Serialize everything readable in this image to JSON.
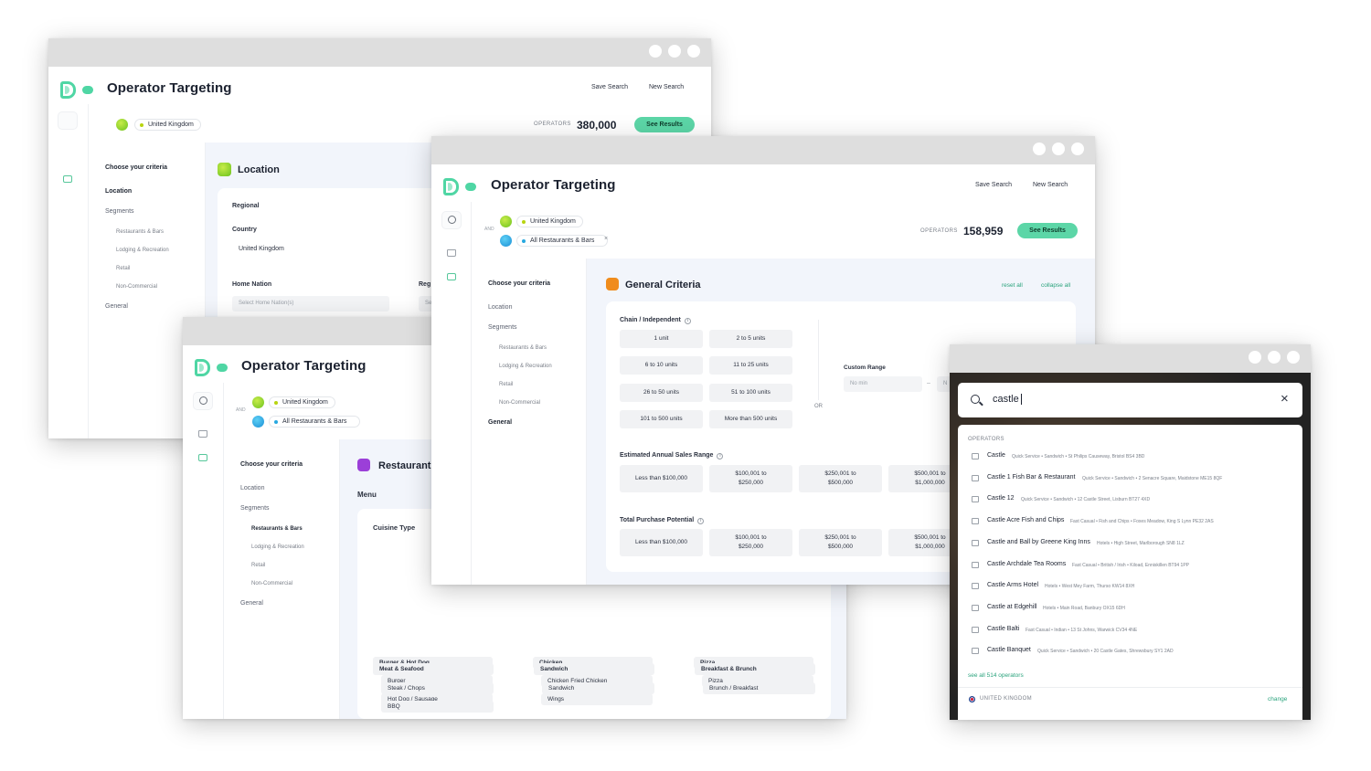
{
  "app": {
    "title": "Operator Targeting",
    "save_search": "Save Search",
    "new_search": "New Search",
    "operators_label": "OPERATORS",
    "see_results": "See Results",
    "and_label": "AND",
    "choose_criteria": "Choose your criteria"
  },
  "brand_colors": {
    "accent": "#5cd6a7",
    "logo": "#4fd6a4",
    "link": "#2aa37c",
    "panel": "#f2f5fb"
  },
  "nav": {
    "location": "Location",
    "segments": "Segments",
    "sub": [
      "Restaurants & Bars",
      "Lodging & Recreation",
      "Retail",
      "Non-Commercial"
    ],
    "general": "General"
  },
  "win1": {
    "filter_pill": "United Kingdom",
    "operators_count": "380,000",
    "section_title": "Location",
    "regional": "Regional",
    "country_label": "Country",
    "country_value": "United Kingdom",
    "home_nation_label": "Home Nation",
    "home_nation_placeholder": "Select Home Nation(s)",
    "region_label_partial": "Reg",
    "region_placeholder_partial": "Se"
  },
  "win3": {
    "filter_location": "United Kingdom",
    "filter_segment": "All Restaurants & Bars",
    "section_title_partial": "Restaurant",
    "menu_label": "Menu",
    "cuisine_label": "Cuisine Type",
    "cuisines": [
      {
        "name": "Burger & Hot Dog",
        "items": [
          "Burger",
          "Hot Dog / Sausage"
        ]
      },
      {
        "name": "Chicken",
        "items": [
          "Chicken Fried Chicken",
          "Wings"
        ]
      },
      {
        "name": "Pizza",
        "items": [
          "Pizza"
        ]
      },
      {
        "name": "Meat & Seafood",
        "items": [
          "Steak / Chops",
          "BBQ"
        ]
      },
      {
        "name": "Sandwich",
        "items": [
          "Sandwich"
        ]
      },
      {
        "name": "Breakfast & Brunch",
        "items": [
          "Brunch / Breakfast"
        ]
      }
    ]
  },
  "win2": {
    "filter_location": "United Kingdom",
    "filter_segment": "All Restaurants & Bars",
    "remove_icon": "×",
    "operators_count": "158,959",
    "section_title": "General Criteria",
    "reset_all": "reset all",
    "collapse_all": "collapse all",
    "chain_label": "Chain / Independent",
    "units": [
      "1 unit",
      "2 to 5 units",
      "6 to 10 units",
      "11 to 25 units",
      "26 to 50 units",
      "51 to 100 units",
      "101 to 500 units",
      "More than 500 units"
    ],
    "or_label": "OR",
    "custom_range_label": "Custom Range",
    "min_placeholder": "No min",
    "range_dash": "–",
    "max_placeholder_partial": "N",
    "sales_label": "Estimated Annual Sales Range",
    "sales_options": [
      "Less than $100,000",
      "$100,001 to $250,000",
      "$250,001 to $500,000",
      "$500,001 to $1,000,000"
    ],
    "purchase_label": "Total Purchase Potential",
    "purchase_options": [
      "Less than $100,000",
      "$100,001 to $250,000",
      "$250,001 to $500,000",
      "$500,001 to $1,000,000"
    ]
  },
  "search": {
    "query": "castle",
    "section_label": "OPERATORS",
    "results": [
      {
        "name": "Castle",
        "meta": "Quick Service  •  Sandwich  •  St Philips Causeway, Bristol BS4 3BD"
      },
      {
        "name": "Castle 1 Fish Bar & Restaurant",
        "meta": "Quick Service  •  Sandwich  •  2 Senacre Square, Maidstone ME15 8QF"
      },
      {
        "name": "Castle 12",
        "meta": "Quick Service  •  Sandwich  •  12 Castle Street, Lisburn BT27 4XD"
      },
      {
        "name": "Castle Acre Fish and Chips",
        "meta": "Fast Casual  •  Fish and Chips  •  Foxes Meadow, King S Lynn PE32 2AS"
      },
      {
        "name": "Castle and Ball by Greene King Inns",
        "meta": "Hotels  •  High Street, Marlborough SN8 1LZ"
      },
      {
        "name": "Castle Archdale Tea Rooms",
        "meta": "Fast Casual  •  British / Irish  •  Kiload, Enniskillen BT94 1PP"
      },
      {
        "name": "Castle Arms Hotel",
        "meta": "Hotels  •  West Mey Farm, Thurso KW14 8XH"
      },
      {
        "name": "Castle at Edgehill",
        "meta": "Hotels  •  Main Road, Banbury OX15 6DH"
      },
      {
        "name": "Castle Balti",
        "meta": "Fast Casual  •  Indian  •  13 St Johns, Warwick CV34 4NE"
      },
      {
        "name": "Castle Banquet",
        "meta": "Quick Service  •  Sandwich  •  20 Castle Gates, Shrewsbury SY1 2AD"
      }
    ],
    "see_all": "see all 514 operators",
    "country": "UNITED KINGDOM",
    "change": "change",
    "clear_icon": "×"
  }
}
